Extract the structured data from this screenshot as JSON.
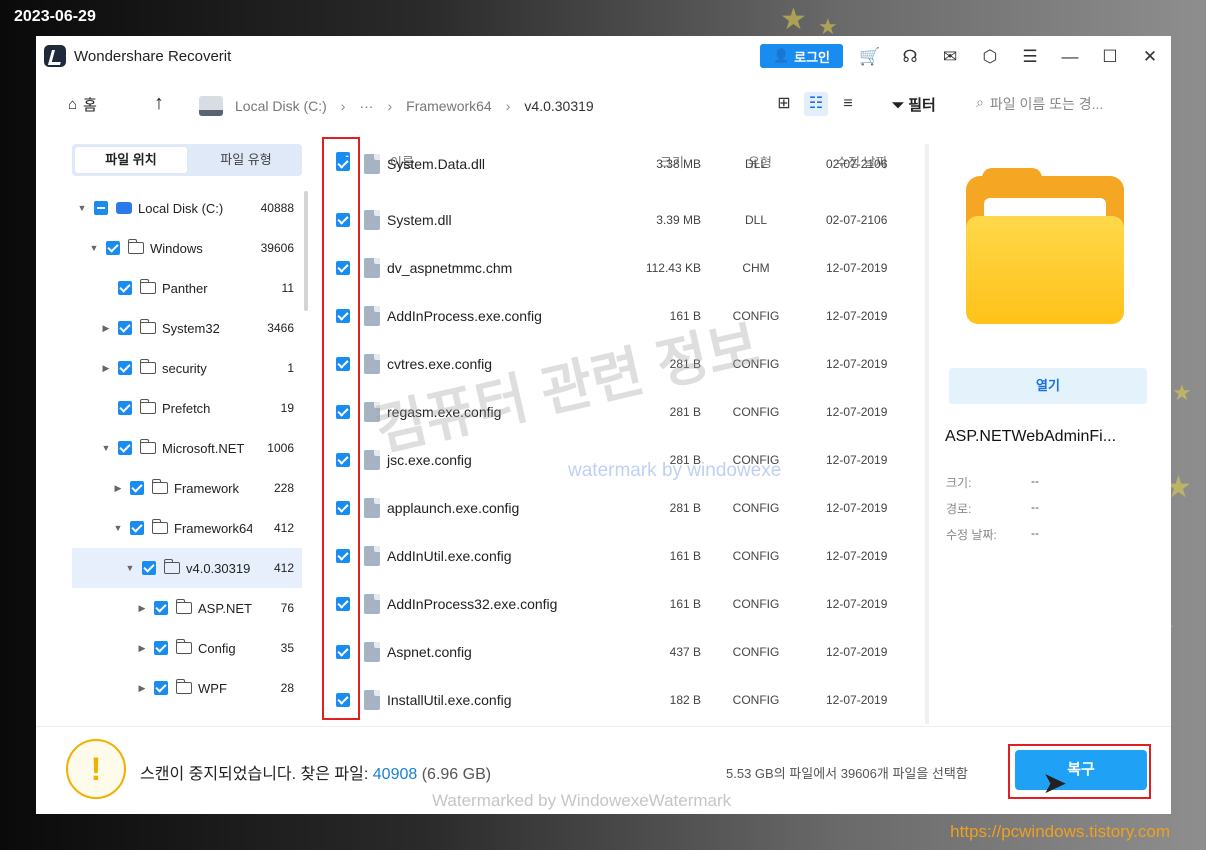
{
  "overlay": {
    "date": "2023-06-29",
    "url": "https://pcwindows.tistory.com"
  },
  "app": {
    "title": "Wondershare Recoverit",
    "login_label": "로그인"
  },
  "nav": {
    "home_label": "홈",
    "crumbs": [
      "Local Disk (C:)",
      "···",
      "Framework64",
      "v4.0.30319"
    ],
    "filter_label": "필터",
    "search_placeholder": "파일 이름 또는 경..."
  },
  "left_panel": {
    "tabs": [
      "파일 위치",
      "파일 유형"
    ],
    "tree": [
      {
        "name": "Local Disk (C:)",
        "count": "40888",
        "expanded": true,
        "type": "drive",
        "check": "partial"
      },
      {
        "name": "Windows",
        "count": "39606",
        "expanded": true,
        "type": "folder",
        "check": "checked"
      },
      {
        "name": "Panther",
        "count": "11",
        "expanded": null,
        "type": "folder",
        "check": "checked"
      },
      {
        "name": "System32",
        "count": "3466",
        "expanded": false,
        "type": "folder",
        "check": "checked"
      },
      {
        "name": "security",
        "count": "1",
        "expanded": false,
        "type": "folder",
        "check": "checked"
      },
      {
        "name": "Prefetch",
        "count": "19",
        "expanded": null,
        "type": "folder",
        "check": "checked"
      },
      {
        "name": "Microsoft.NET",
        "count": "1006",
        "expanded": true,
        "type": "folder",
        "check": "checked"
      },
      {
        "name": "Framework",
        "count": "228",
        "expanded": false,
        "type": "folder",
        "check": "checked"
      },
      {
        "name": "Framework64",
        "count": "412",
        "expanded": true,
        "type": "folder",
        "check": "checked"
      },
      {
        "name": "v4.0.30319",
        "count": "412",
        "expanded": true,
        "type": "folder",
        "check": "checked",
        "selected": true
      },
      {
        "name": "ASP.NETW...",
        "count": "76",
        "expanded": false,
        "type": "folder",
        "check": "checked"
      },
      {
        "name": "Config",
        "count": "35",
        "expanded": false,
        "type": "folder",
        "check": "checked"
      },
      {
        "name": "WPF",
        "count": "28",
        "expanded": false,
        "type": "folder",
        "check": "checked"
      }
    ]
  },
  "file_list": {
    "headers": {
      "name": "이름",
      "size": "크기",
      "type": "유형",
      "date": "수정 날짜"
    },
    "rows": [
      {
        "name": "System.Data.dll",
        "size": "3.38 MB",
        "type": "DLL",
        "date": "02-07-2106"
      },
      {
        "name": "System.dll",
        "size": "3.39 MB",
        "type": "DLL",
        "date": "02-07-2106"
      },
      {
        "name": "dv_aspnetmmc.chm",
        "size": "112.43 KB",
        "type": "CHM",
        "date": "12-07-2019"
      },
      {
        "name": "AddInProcess.exe.config",
        "size": "161 B",
        "type": "CONFIG",
        "date": "12-07-2019"
      },
      {
        "name": "cvtres.exe.config",
        "size": "281 B",
        "type": "CONFIG",
        "date": "12-07-2019"
      },
      {
        "name": "regasm.exe.config",
        "size": "281 B",
        "type": "CONFIG",
        "date": "12-07-2019"
      },
      {
        "name": "jsc.exe.config",
        "size": "281 B",
        "type": "CONFIG",
        "date": "12-07-2019"
      },
      {
        "name": "applaunch.exe.config",
        "size": "281 B",
        "type": "CONFIG",
        "date": "12-07-2019"
      },
      {
        "name": "AddInUtil.exe.config",
        "size": "161 B",
        "type": "CONFIG",
        "date": "12-07-2019"
      },
      {
        "name": "AddInProcess32.exe.config",
        "size": "161 B",
        "type": "CONFIG",
        "date": "12-07-2019"
      },
      {
        "name": "Aspnet.config",
        "size": "437 B",
        "type": "CONFIG",
        "date": "12-07-2019"
      },
      {
        "name": "InstallUtil.exe.config",
        "size": "182 B",
        "type": "CONFIG",
        "date": "12-07-2019"
      }
    ]
  },
  "preview": {
    "open_label": "열기",
    "name": "ASP.NETWebAdminFi...",
    "fields": [
      {
        "label": "크기:",
        "value": "--"
      },
      {
        "label": "경로:",
        "value": "--"
      },
      {
        "label": "수정 날짜:",
        "value": "--"
      }
    ]
  },
  "footer": {
    "status_prefix": "스캔이 중지되었습니다. 찾은 파일:",
    "found_count": "40908",
    "found_size": "(6.96 GB)",
    "selection_info": "5.53 GB의 파일에서 39606개 파일을 선택함",
    "recover_label": "복구"
  },
  "watermarks": {
    "korean": "컴퓨터 관련 정보",
    "english": "watermark by windowexe",
    "bottom": "Watermarked by WindowexeWatermark"
  },
  "colors": {
    "accent": "#1a8cf0",
    "warning": "#f0b000",
    "highlight_box": "#e02020"
  }
}
